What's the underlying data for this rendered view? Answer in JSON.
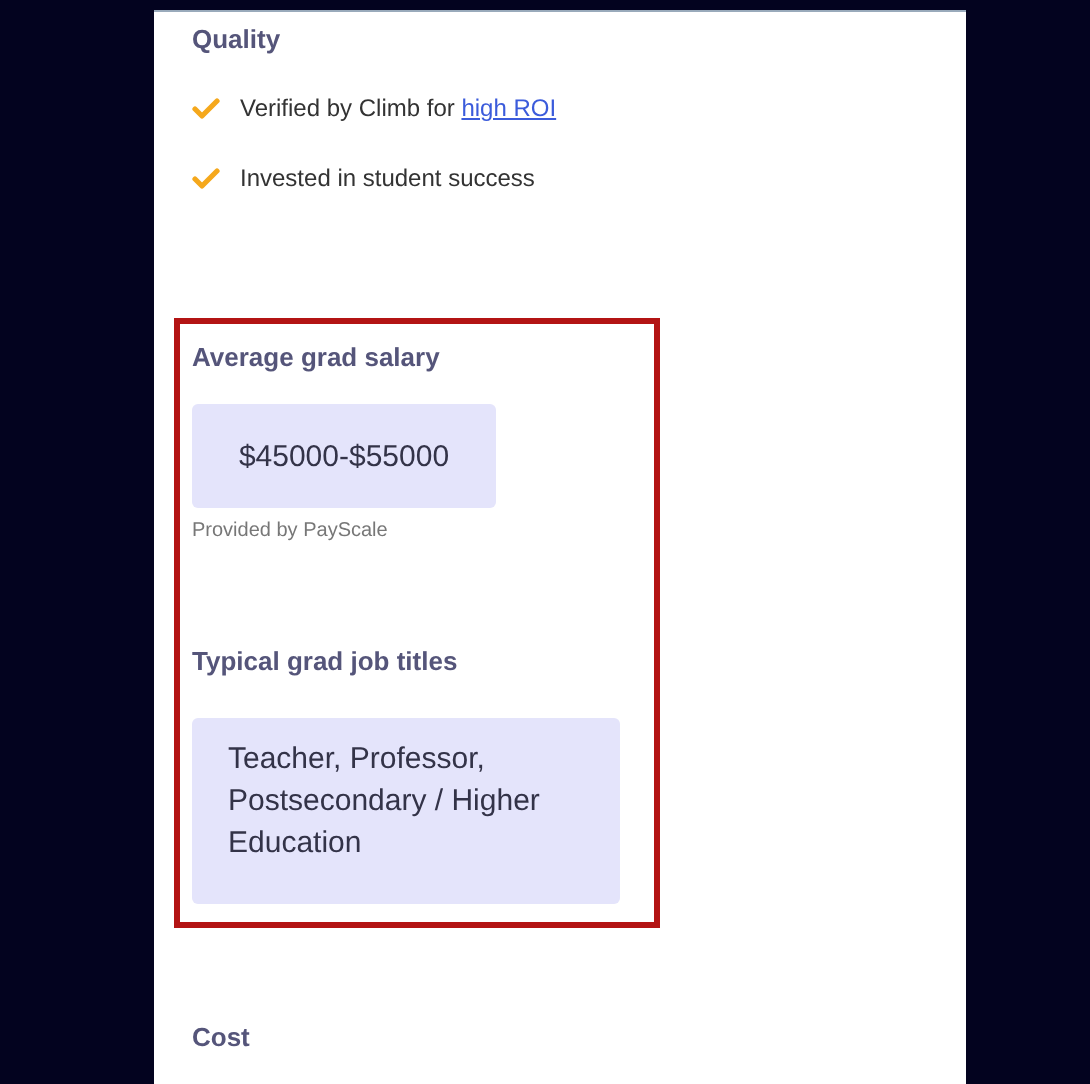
{
  "quality": {
    "heading": "Quality",
    "items": [
      {
        "text": "Verified by Climb for ",
        "link": "high ROI"
      },
      {
        "text": "Invested in student success"
      }
    ]
  },
  "salary": {
    "heading": "Average grad salary",
    "value": "$45000-$55000",
    "source": "Provided by PayScale"
  },
  "job_titles": {
    "heading": "Typical grad job titles",
    "value": "Teacher, Professor, Postsecondary / Higher Education"
  },
  "cost": {
    "heading": "Cost"
  }
}
